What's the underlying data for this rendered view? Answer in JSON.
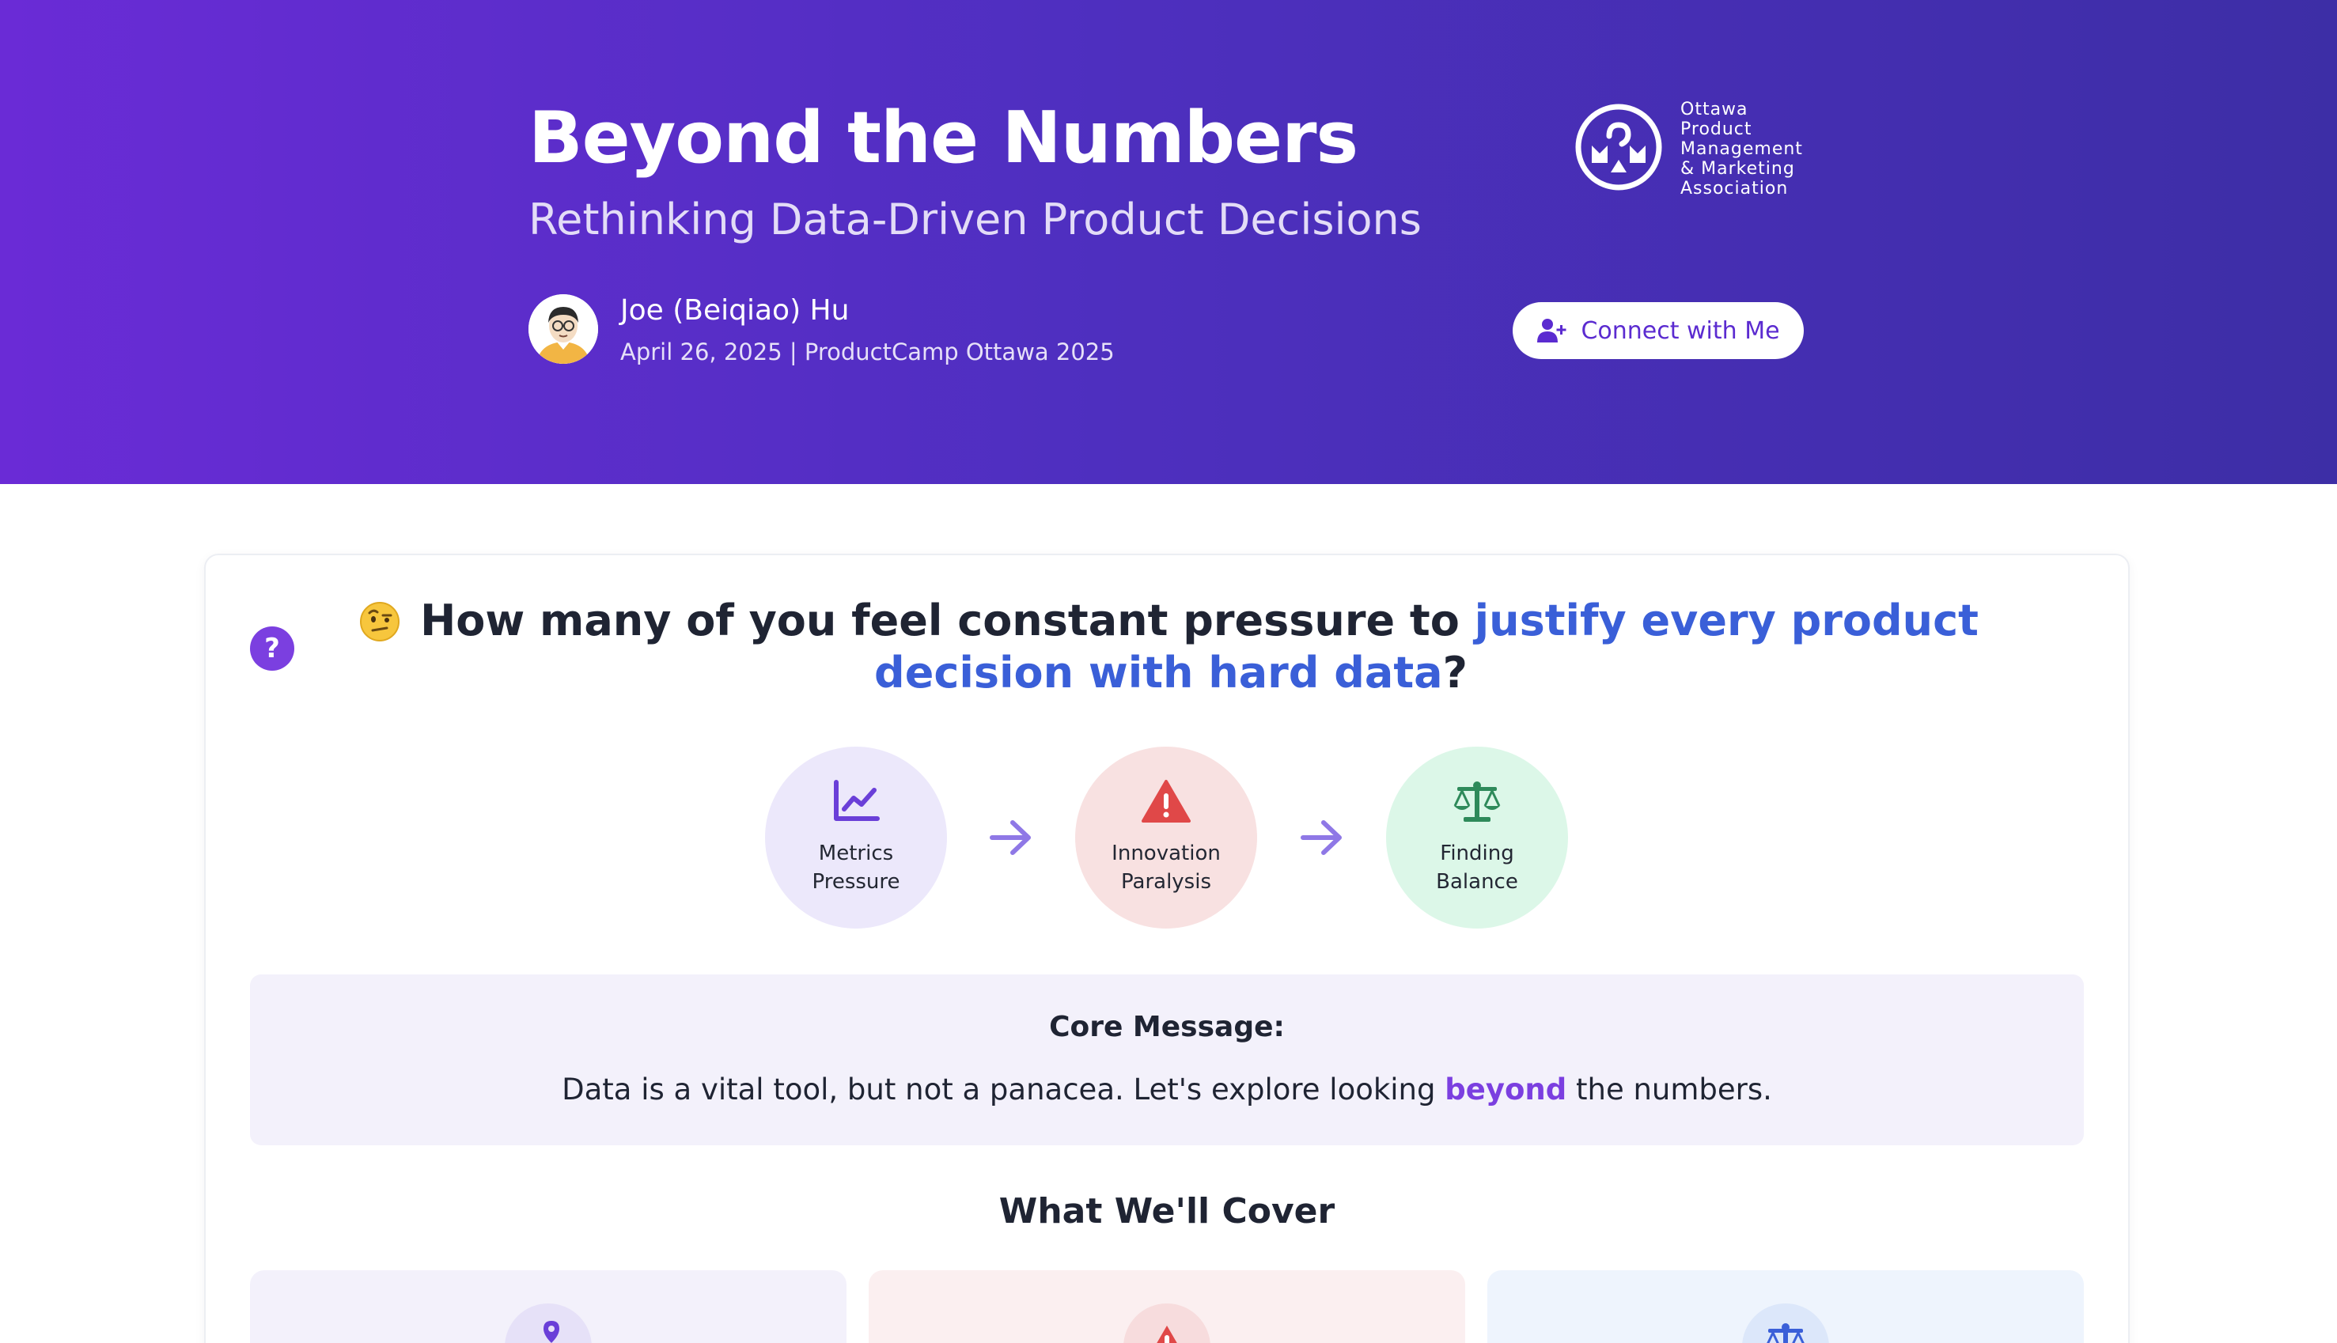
{
  "header": {
    "title": "Beyond the Numbers",
    "subtitle": "Rethinking Data-Driven Product Decisions",
    "author_name": "Joe (Beiqiao) Hu",
    "author_meta": "April 26, 2025 | ProductCamp Ottawa 2025",
    "connect_label": "Connect with Me",
    "org_name_lines": [
      "Ottawa",
      "Product",
      "Management",
      "& Marketing",
      "Association"
    ]
  },
  "main": {
    "question_badge": "?",
    "question_emoji": "face-with-raised-eyebrow",
    "question_pre": "How many of you feel constant pressure to ",
    "question_highlight": "justify every product decision with hard data",
    "question_post": "?",
    "flow": [
      {
        "label": "Metrics Pressure",
        "icon": "chart-line-icon",
        "color": "#6a3fd8"
      },
      {
        "label": "Innovation Paralysis",
        "icon": "warning-icon",
        "color": "#e04848"
      },
      {
        "label": "Finding Balance",
        "icon": "scale-icon",
        "color": "#2e8a5a"
      }
    ],
    "core": {
      "title": "Core Message:",
      "text_pre": "Data is a vital tool, but not a panacea. Let's explore looking ",
      "text_highlight": "beyond",
      "text_post": " the numbers."
    },
    "cover_title": "What We'll Cover"
  },
  "colors": {
    "accent_purple": "#7b3fe0",
    "highlight_blue": "#3a5fd8",
    "header_gradient_start": "#6a2bd6",
    "header_gradient_end": "#3d2ea6"
  }
}
